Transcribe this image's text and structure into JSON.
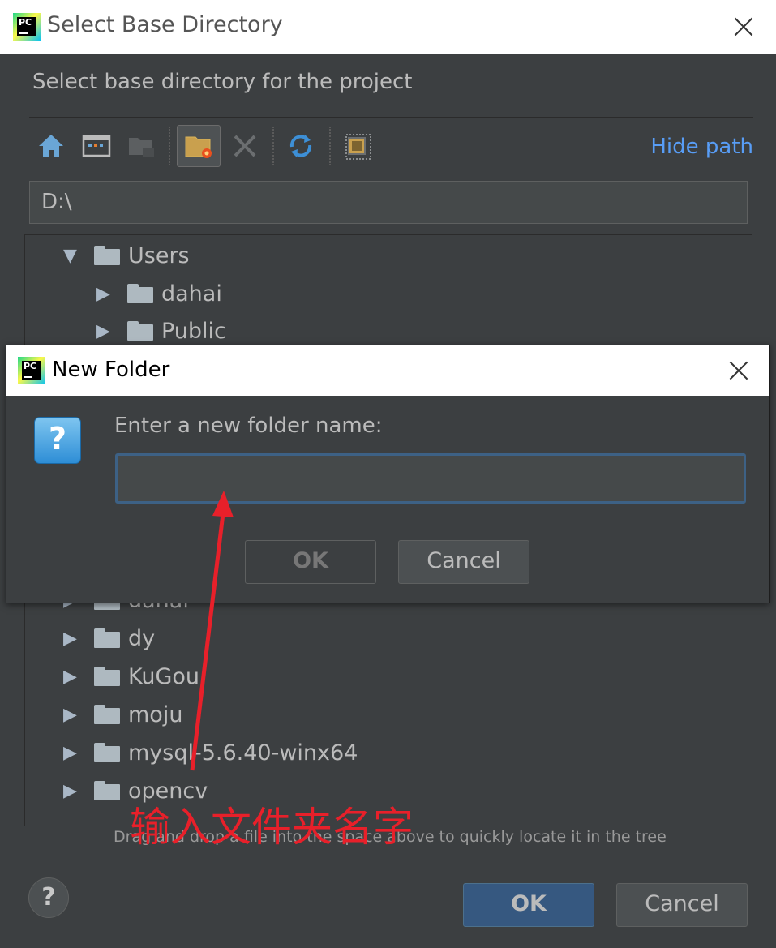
{
  "outer_dialog": {
    "title": "Select Base Directory",
    "description": "Select base directory for the project",
    "hide_path_label": "Hide path",
    "path_value": "D:\\",
    "hint": "Drag and drop a file into the space above to quickly locate it in the tree",
    "help_label": "?",
    "ok_label": "OK",
    "cancel_label": "Cancel",
    "logo_text": "PC",
    "toolbar": [
      "home-icon",
      "desktop-icon",
      "project-folder-icon",
      "new-folder-icon",
      "delete-icon",
      "refresh-icon",
      "show-hidden-icon"
    ]
  },
  "tree": {
    "rows": [
      {
        "label": "Users",
        "expanded": true
      },
      {
        "label": "dahai",
        "expanded": false
      },
      {
        "label": "Public",
        "expanded": false
      },
      {
        "label": "dahai",
        "expanded": false
      },
      {
        "label": "dy",
        "expanded": false
      },
      {
        "label": "KuGou",
        "expanded": false
      },
      {
        "label": "moju",
        "expanded": false
      },
      {
        "label": "mysql-5.6.40-winx64",
        "expanded": false
      },
      {
        "label": "opencv",
        "expanded": false
      }
    ],
    "expanded_glyph": "▼",
    "collapsed_glyph": "▶"
  },
  "new_folder_dialog": {
    "title": "New Folder",
    "logo_text": "PC",
    "icon_glyph": "?",
    "prompt": "Enter a new folder name:",
    "input_value": "",
    "ok_label": "OK",
    "cancel_label": "Cancel"
  },
  "annotation": {
    "text": "输入文件夹名字",
    "color": "#e8202a"
  },
  "colors": {
    "background": "#3c3f41",
    "link": "#589df6",
    "primary_button": "#365880"
  }
}
